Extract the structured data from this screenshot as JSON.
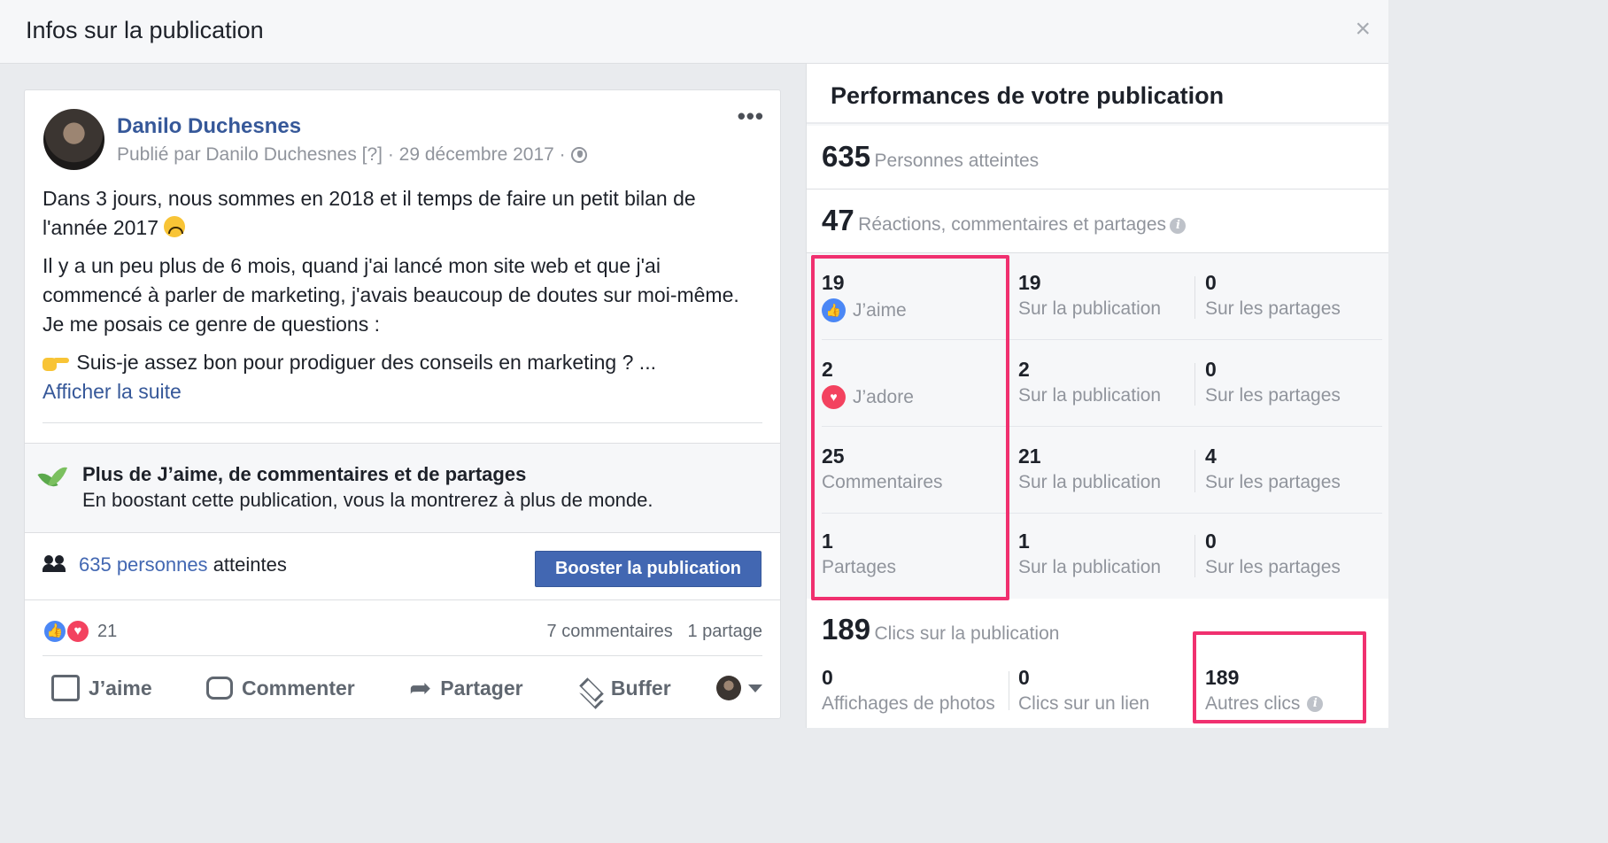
{
  "dialog": {
    "title": "Infos sur la publication",
    "close_icon": "×"
  },
  "post": {
    "author": "Danilo Duchesnes",
    "meta": "Publié par Danilo Duchesnes [?] · 29 décembre 2017 ·",
    "more_icon": "•••",
    "paragraph1": "Dans 3 jours, nous sommes en 2018 et il temps de faire un petit bilan de l'année 2017",
    "paragraph2": "Il y a un peu plus de 6 mois, quand j'ai lancé mon site web et que j'ai commencé à parler de marketing, j'avais beaucoup de doutes sur moi-même. Je me posais ce genre de questions :",
    "paragraph3": "Suis-je assez bon pour prodiguer des conseils en marketing ? ...",
    "see_more": "Afficher la suite",
    "boost_title": "Plus de J’aime, de commentaires et de partages",
    "boost_subtitle": "En boostant cette publication, vous la montrerez à plus de monde.",
    "reach_link": "635 personnes",
    "reach_suffix": "atteintes",
    "boost_button": "Booster la publication",
    "reactions_count": "21",
    "comments": "7 commentaires",
    "shares": "1 partage",
    "actions": {
      "like": "J’aime",
      "comment": "Commenter",
      "share": "Partager",
      "buffer": "Buffer"
    }
  },
  "performance": {
    "title": "Performances de votre publication",
    "reached": {
      "value": "635",
      "label": "Personnes atteintes"
    },
    "engagement": {
      "value": "47",
      "label": "Réactions, commentaires et partages"
    },
    "rows": [
      {
        "value": "19",
        "label": "J’aime",
        "icon": "like-icon",
        "post_value": "19",
        "post_label": "Sur la publication",
        "share_value": "0",
        "share_label": "Sur les partages"
      },
      {
        "value": "2",
        "label": "J’adore",
        "icon": "love-icon",
        "post_value": "2",
        "post_label": "Sur la publication",
        "share_value": "0",
        "share_label": "Sur les partages"
      },
      {
        "value": "25",
        "label": "Commentaires",
        "post_value": "21",
        "post_label": "Sur la publication",
        "share_value": "4",
        "share_label": "Sur les partages"
      },
      {
        "value": "1",
        "label": "Partages",
        "post_value": "1",
        "post_label": "Sur la publication",
        "share_value": "0",
        "share_label": "Sur les partages"
      }
    ],
    "clicks": {
      "value": "189",
      "label": "Clics sur la publication"
    },
    "click_breakdown": [
      {
        "value": "0",
        "label": "Affichages de photos"
      },
      {
        "value": "0",
        "label": "Clics sur un lien"
      },
      {
        "value": "189",
        "label": "Autres clics"
      }
    ]
  },
  "colors": {
    "link": "#365899",
    "button": "#4267b2",
    "highlight": "#f0306f",
    "like": "#4b87f5",
    "love": "#f3425f"
  }
}
